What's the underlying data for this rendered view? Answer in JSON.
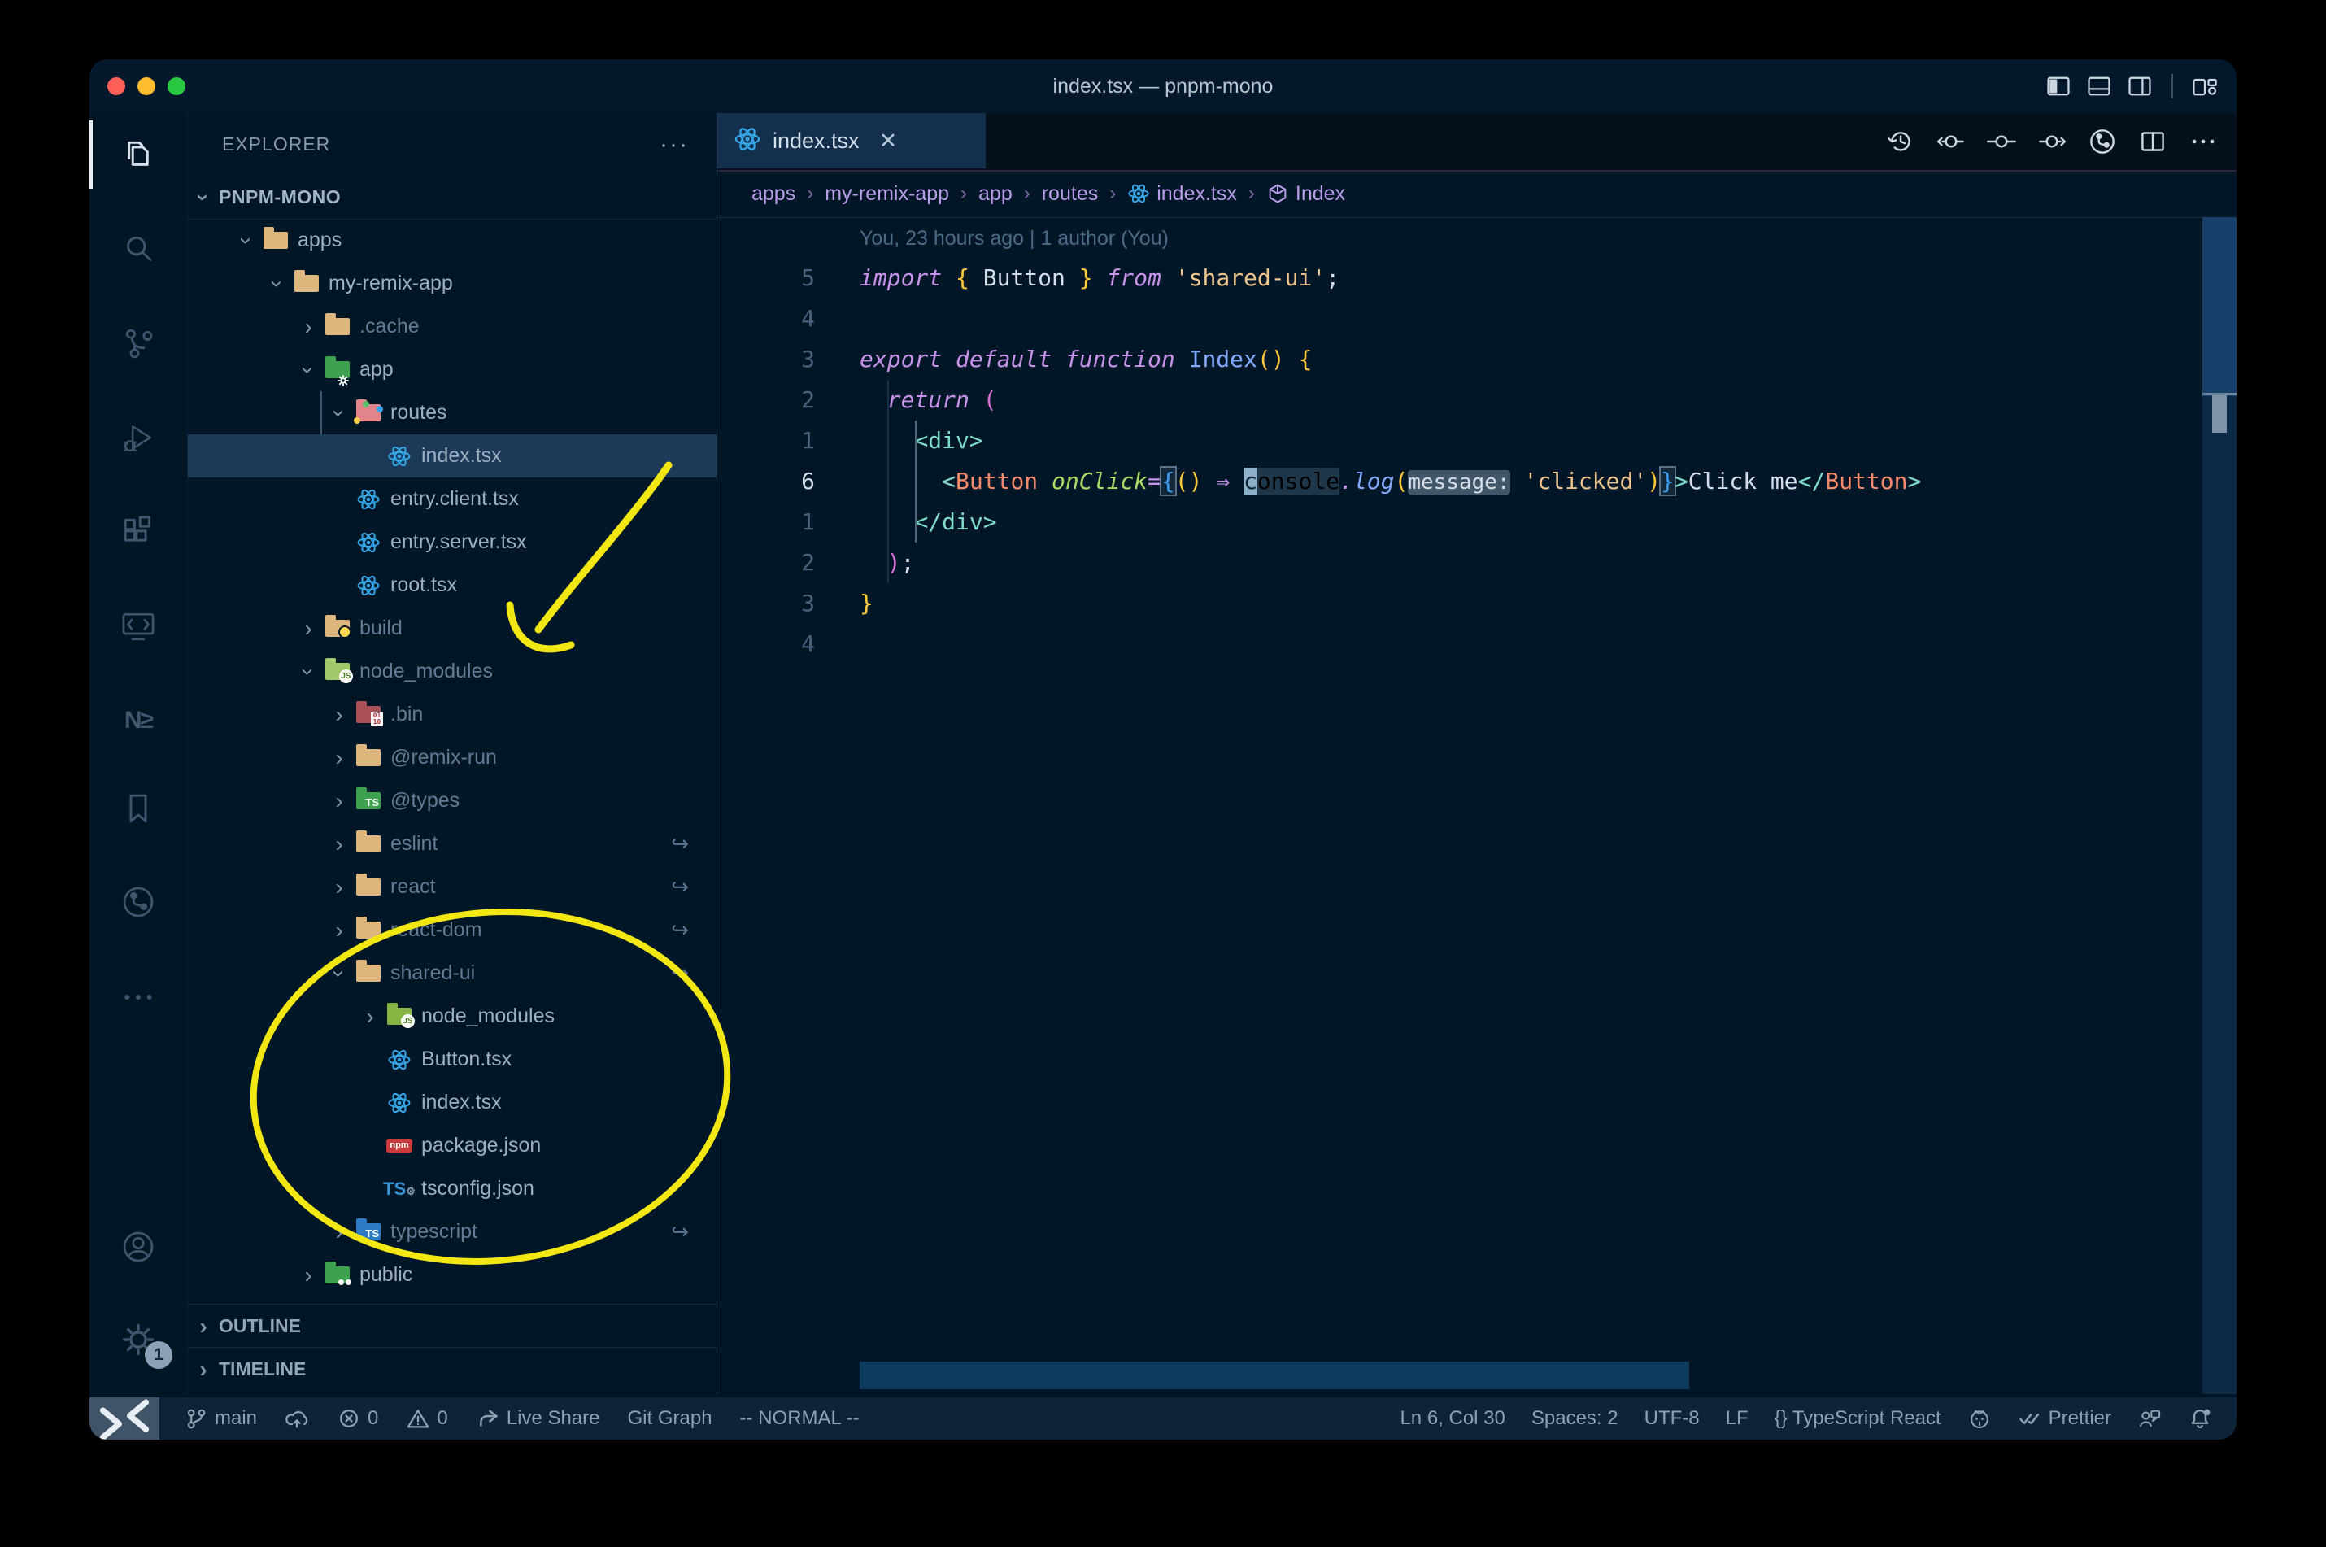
{
  "window": {
    "title": "index.tsx — pnpm-mono"
  },
  "titlebar": {
    "layout_icons": [
      "layout-sidebar-left",
      "layout-panel",
      "layout-sidebar-right",
      "layout-customize"
    ]
  },
  "activity_bar": {
    "top": [
      {
        "name": "explorer",
        "icon": "files",
        "active": true
      },
      {
        "name": "search",
        "icon": "search"
      },
      {
        "name": "source-control",
        "icon": "scm"
      },
      {
        "name": "run-debug",
        "icon": "debug"
      },
      {
        "name": "extensions",
        "icon": "extensions"
      },
      {
        "name": "remote-explorer",
        "icon": "remote-explorer"
      },
      {
        "name": "nx-console",
        "icon": "nx"
      },
      {
        "name": "bookmarks",
        "icon": "bookmark"
      },
      {
        "name": "git-graph",
        "icon": "gitgraph"
      },
      {
        "name": "more-views",
        "icon": "dots"
      }
    ],
    "bottom": [
      {
        "name": "accounts",
        "icon": "account"
      },
      {
        "name": "settings",
        "icon": "gear",
        "badge": "1"
      }
    ]
  },
  "explorer": {
    "title": "EXPLORER",
    "more_label": "···",
    "workspace": "PNPM-MONO",
    "tree": [
      {
        "label": "apps",
        "level": 1,
        "kind": "folder",
        "state": "open",
        "icon": "folder-tan"
      },
      {
        "label": "my-remix-app",
        "level": 2,
        "kind": "folder",
        "state": "open",
        "icon": "folder-tan"
      },
      {
        "label": ".cache",
        "level": 3,
        "kind": "folder",
        "state": "closed",
        "icon": "folder-tan",
        "dim": true
      },
      {
        "label": "app",
        "level": 3,
        "kind": "folder",
        "state": "open",
        "icon": "folder-app"
      },
      {
        "label": "routes",
        "level": 4,
        "kind": "folder",
        "state": "open",
        "icon": "folder-routes"
      },
      {
        "label": "index.tsx",
        "level": 5,
        "kind": "file",
        "icon": "react",
        "selected": true
      },
      {
        "label": "entry.client.tsx",
        "level": 4,
        "kind": "file",
        "icon": "react"
      },
      {
        "label": "entry.server.tsx",
        "level": 4,
        "kind": "file",
        "icon": "react"
      },
      {
        "label": "root.tsx",
        "level": 4,
        "kind": "file",
        "icon": "react"
      },
      {
        "label": "build",
        "level": 3,
        "kind": "folder",
        "state": "closed",
        "icon": "folder-build",
        "dim": true
      },
      {
        "label": "node_modules",
        "level": 3,
        "kind": "folder",
        "state": "open",
        "icon": "folder-node",
        "dim": true
      },
      {
        "label": ".bin",
        "level": 4,
        "kind": "folder",
        "state": "closed",
        "icon": "folder-bin",
        "dim": true
      },
      {
        "label": "@remix-run",
        "level": 4,
        "kind": "folder",
        "state": "closed",
        "icon": "folder-tan",
        "dim": true
      },
      {
        "label": "@types",
        "level": 4,
        "kind": "folder",
        "state": "closed",
        "icon": "folder-types",
        "dim": true
      },
      {
        "label": "eslint",
        "level": 4,
        "kind": "folder",
        "state": "closed",
        "icon": "folder-tan",
        "dim": true,
        "symlink": true
      },
      {
        "label": "react",
        "level": 4,
        "kind": "folder",
        "state": "closed",
        "icon": "folder-tan",
        "dim": true,
        "symlink": true
      },
      {
        "label": "react-dom",
        "level": 4,
        "kind": "folder",
        "state": "closed",
        "icon": "folder-tan",
        "dim": true,
        "symlink": true
      },
      {
        "label": "shared-ui",
        "level": 4,
        "kind": "folder",
        "state": "open",
        "icon": "folder-tan",
        "dim": true,
        "symlink": true
      },
      {
        "label": "node_modules",
        "level": 5,
        "kind": "folder",
        "state": "closed",
        "icon": "folder-nodeh"
      },
      {
        "label": "Button.tsx",
        "level": 5,
        "kind": "file",
        "icon": "react"
      },
      {
        "label": "index.tsx",
        "level": 5,
        "kind": "file",
        "icon": "react"
      },
      {
        "label": "package.json",
        "level": 5,
        "kind": "file",
        "icon": "npm"
      },
      {
        "label": "tsconfig.json",
        "level": 5,
        "kind": "file",
        "icon": "tsconfig"
      },
      {
        "label": "typescript",
        "level": 4,
        "kind": "folder",
        "state": "closed",
        "icon": "folder-ts",
        "dim": true,
        "symlink": true
      },
      {
        "label": "public",
        "level": 3,
        "kind": "folder",
        "state": "closed",
        "icon": "folder-public"
      }
    ],
    "panels": [
      "OUTLINE",
      "TIMELINE"
    ]
  },
  "editor": {
    "tab": {
      "label": "index.tsx",
      "icon": "react",
      "close": "✕"
    },
    "actions": [
      "history",
      "change-prev",
      "commit",
      "change-next",
      "gitgraph-bright",
      "split",
      "dots"
    ],
    "breadcrumbs": [
      {
        "label": "apps"
      },
      {
        "label": "my-remix-app"
      },
      {
        "label": "app"
      },
      {
        "label": "routes"
      },
      {
        "label": "index.tsx",
        "icon": "react"
      },
      {
        "label": "Index",
        "icon": "cube"
      }
    ],
    "code": {
      "lines": [
        {
          "tokens": [
            [
              "You, 23 hours ago | 1 author (You)",
              "blame"
            ]
          ]
        },
        {
          "num": "5",
          "tokens": [
            [
              "import ",
              "kw"
            ],
            [
              "{",
              "b1"
            ],
            [
              " Button ",
              "p"
            ],
            [
              "}",
              "b1"
            ],
            [
              " ",
              "p"
            ],
            [
              "from",
              "kw"
            ],
            [
              " ",
              "p"
            ],
            [
              "'shared-ui'",
              "str"
            ],
            [
              ";",
              "p"
            ]
          ]
        },
        {
          "num": "4",
          "tokens": []
        },
        {
          "num": "3",
          "tokens": [
            [
              "export ",
              "kw"
            ],
            [
              "default ",
              "kw"
            ],
            [
              "function ",
              "kw"
            ],
            [
              "Index",
              "fname"
            ],
            [
              "(",
              "b1"
            ],
            [
              ")",
              "b1"
            ],
            [
              " ",
              "p"
            ],
            [
              "{",
              "b1"
            ]
          ]
        },
        {
          "num": "2",
          "tokens": [
            [
              "  ",
              "p"
            ],
            [
              "return",
              "kw"
            ],
            [
              " ",
              "p"
            ],
            [
              "(",
              "b2"
            ]
          ]
        },
        {
          "num": "1",
          "tokens": [
            [
              "    ",
              "p"
            ],
            [
              "<div>",
              "tag"
            ]
          ]
        },
        {
          "num": "6",
          "current": true,
          "tokens": [
            [
              "      ",
              "p"
            ],
            [
              "<",
              "tag"
            ],
            [
              "Button",
              "cmp"
            ],
            [
              " ",
              "p"
            ],
            [
              "onClick",
              "attr"
            ],
            [
              "=",
              "kw"
            ],
            [
              "{",
              "b3 bm"
            ],
            [
              "(",
              "b1"
            ],
            [
              ")",
              "b1"
            ],
            [
              " ",
              "p"
            ],
            [
              "⇒",
              "kw"
            ],
            [
              " ",
              "p"
            ],
            [
              "c",
              "cursor"
            ],
            [
              "onsole",
              "whl"
            ],
            [
              ".",
              "kw"
            ],
            [
              "log",
              "fn"
            ],
            [
              "(",
              "b1"
            ],
            [
              "message:",
              "inlay"
            ],
            [
              " ",
              "p"
            ],
            [
              "'clicked'",
              "str"
            ],
            [
              ")",
              "b1"
            ],
            [
              "}",
              "b3 bm"
            ],
            [
              ">",
              "tag"
            ],
            [
              "Click me",
              "p"
            ],
            [
              "</",
              "tag"
            ],
            [
              "Button",
              "cmp"
            ],
            [
              ">",
              "tag"
            ]
          ]
        },
        {
          "num": "1",
          "tokens": [
            [
              "    ",
              "p"
            ],
            [
              "</div>",
              "tag"
            ]
          ]
        },
        {
          "num": "2",
          "tokens": [
            [
              "  ",
              "p"
            ],
            [
              ")",
              "b2"
            ],
            [
              ";",
              "p"
            ]
          ]
        },
        {
          "num": "3",
          "tokens": [
            [
              "}",
              "b1"
            ]
          ]
        },
        {
          "num": "4",
          "tokens": []
        }
      ]
    }
  },
  "status_bar": {
    "left": [
      {
        "name": "branch",
        "icon": "branch",
        "text": "main"
      },
      {
        "name": "sync",
        "icon": "cloud"
      },
      {
        "name": "errors",
        "icon": "err",
        "text": "0"
      },
      {
        "name": "warnings",
        "icon": "warn",
        "text": "0"
      },
      {
        "name": "live-share",
        "icon": "share",
        "text": "Live Share"
      },
      {
        "name": "git-graph",
        "text": "Git Graph"
      },
      {
        "name": "vim-mode",
        "text": "-- NORMAL --"
      }
    ],
    "right": [
      {
        "name": "cursor-position",
        "text": "Ln 6, Col 30"
      },
      {
        "name": "indentation",
        "text": "Spaces: 2"
      },
      {
        "name": "encoding",
        "text": "UTF-8"
      },
      {
        "name": "eol",
        "text": "LF"
      },
      {
        "name": "language-mode",
        "text": "{} TypeScript React"
      },
      {
        "name": "github",
        "icon": "octo"
      },
      {
        "name": "formatter",
        "icon": "checks",
        "text": "Prettier"
      },
      {
        "name": "feedback",
        "icon": "feedback"
      },
      {
        "name": "notifications",
        "icon": "bell"
      }
    ]
  },
  "annotations": {
    "highlight_color": "#f2e713"
  },
  "colors": {
    "editor_bg": "#011627",
    "active_tab_bg": "#14304d",
    "selection_row": "#1c3a57",
    "breadcrumb": "#b79ce8",
    "keyword": "#c792ea",
    "string": "#ecc48d",
    "tag": "#7fdbca",
    "component": "#f78c6c",
    "attribute": "#addb67",
    "function": "#82aaff",
    "bracket_gold": "#ffcb3a",
    "bracket_pink": "#d670d6",
    "bracket_blue": "#3c9cf0",
    "traffic_red": "#ff5f57",
    "traffic_yellow": "#febc2e",
    "traffic_green": "#28c840"
  }
}
